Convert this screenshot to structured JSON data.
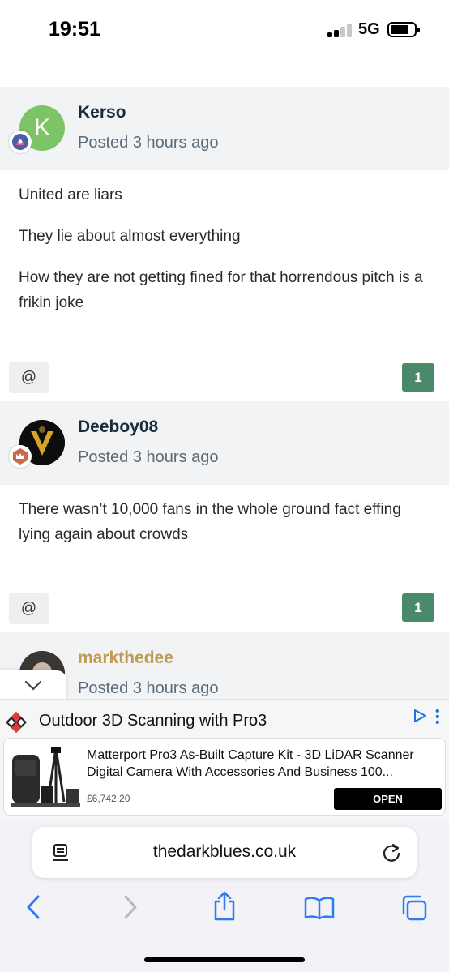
{
  "status_bar": {
    "time": "19:51",
    "network": "5G"
  },
  "posts": [
    {
      "author": "Kerso",
      "author_color": "#1b2b3c",
      "posted": "Posted 3 hours ago",
      "avatar_letter": "K",
      "avatar_color": "#7cc466",
      "badge_icon": "rank-star-badge-icon",
      "body": [
        "United are liars",
        "They lie about almost everything",
        "How they are not getting fined for that horrendous pitch is a frikin joke"
      ],
      "mention_label": "@",
      "reaction_count": "1"
    },
    {
      "author": "Deeboy08",
      "author_color": "#1b2b3c",
      "posted": "Posted 3 hours ago",
      "avatar_icon": "gold-v-logo-avatar",
      "badge_icon": "crown-badge-icon",
      "body": [
        "There wasn’t 10,000 fans in the whole ground fact effing lying again about crowds"
      ],
      "mention_label": "@",
      "reaction_count": "1"
    },
    {
      "author": "markthedee",
      "author_color": "#c19a55",
      "posted": "Posted 3 hours ago",
      "avatar_icon": "photo-avatar"
    }
  ],
  "ad": {
    "title": "Outdoor 3D Scanning with Pro3",
    "description": "Matterport Pro3 As-Built Capture Kit - 3D LiDAR Scanner Digital Camera With Accessories And Business 100...",
    "price": "£6,742.20",
    "cta": "OPEN"
  },
  "browser": {
    "url": "thedarkblues.co.uk"
  },
  "colors": {
    "accent": "#1a73e8",
    "reaction_green": "#4b8a68"
  }
}
